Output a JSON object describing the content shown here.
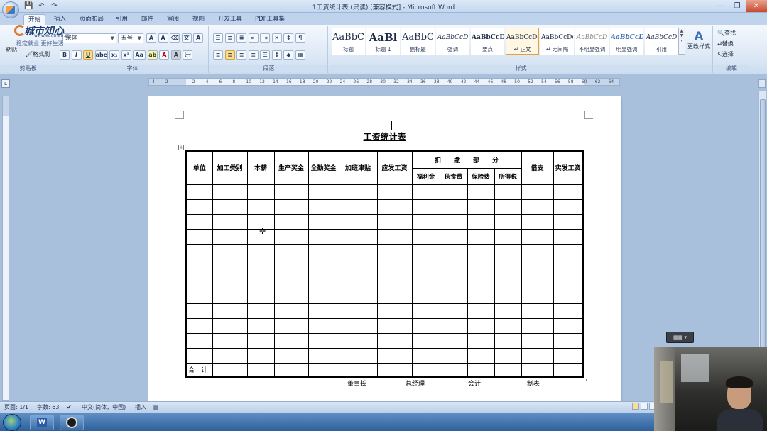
{
  "titlebar": {
    "doc_title": "1工资统计表 (只读) [兼容模式] - Microsoft Word",
    "controls": [
      "—",
      "❐",
      "✕"
    ]
  },
  "watermark": {
    "brand": "城市知心",
    "url": "www.edutrain.cn",
    "slogan": "稳定就业  更好生活"
  },
  "tabs": [
    "开始",
    "插入",
    "页面布局",
    "引用",
    "邮件",
    "审阅",
    "视图",
    "开发工具",
    "PDF工具集"
  ],
  "ribbon": {
    "clipboard": {
      "label": "剪贴板",
      "paste": "粘贴",
      "format_painter": "格式刷"
    },
    "font": {
      "label": "字体",
      "font_name": "宋体",
      "font_size": "五号",
      "buttons": [
        "B",
        "I",
        "U",
        "abe",
        "x₂",
        "x²",
        "Aa",
        "A",
        "A"
      ]
    },
    "paragraph": {
      "label": "段落"
    },
    "styles": {
      "label": "样式",
      "items": [
        {
          "preview": "AaBbC",
          "name": "标题"
        },
        {
          "preview": "AaBl",
          "name": "标题 1"
        },
        {
          "preview": "AaBbC",
          "name": "副标题"
        },
        {
          "preview": "AaBbCcD",
          "name": "强调"
        },
        {
          "preview": "AaBbCcD",
          "name": "要点"
        },
        {
          "preview": "AaBbCcDc",
          "name": "↵ 正文"
        },
        {
          "preview": "AaBbCcDc",
          "name": "↵ 无间隔"
        },
        {
          "preview": "AaBbCcD",
          "name": "不明显强调"
        },
        {
          "preview": "AaBbCcD",
          "name": "明显强调"
        },
        {
          "preview": "AaBbCcD",
          "name": "引用"
        }
      ],
      "change_styles": "更改样式"
    },
    "editing": {
      "label": "编辑",
      "find": "查找",
      "replace": "替换",
      "select": "选择"
    }
  },
  "ruler": {
    "ticks": [
      "4",
      "2",
      "",
      "2",
      "4",
      "6",
      "8",
      "10",
      "12",
      "14",
      "16",
      "18",
      "20",
      "22",
      "24",
      "26",
      "28",
      "30",
      "32",
      "34",
      "36",
      "38",
      "40",
      "42",
      "44",
      "46",
      "48",
      "50",
      "52",
      "54",
      "56",
      "58",
      "60",
      "62",
      "64"
    ]
  },
  "document": {
    "heading": "工资统计表",
    "table": {
      "headers": [
        "单位",
        "加工类别",
        "本薪",
        "生产奖金",
        "全勤奖金",
        "加班津贴",
        "应发工资",
        "扣　　缴　　部　　分",
        "借支",
        "实发工资"
      ],
      "deduction_headers": [
        "福利金",
        "伙食费",
        "保险费",
        "所得税"
      ],
      "empty_rows": 12,
      "total_label": "合　计"
    },
    "signers": [
      "董事长",
      "总经理",
      "会计",
      "制表"
    ]
  },
  "statusbar": {
    "page": "页面: 1/1",
    "words": "字数: 63",
    "language": "中文(简体，中国)",
    "insert_mode": "插入"
  },
  "mini_tool": "▦▦ ▾"
}
